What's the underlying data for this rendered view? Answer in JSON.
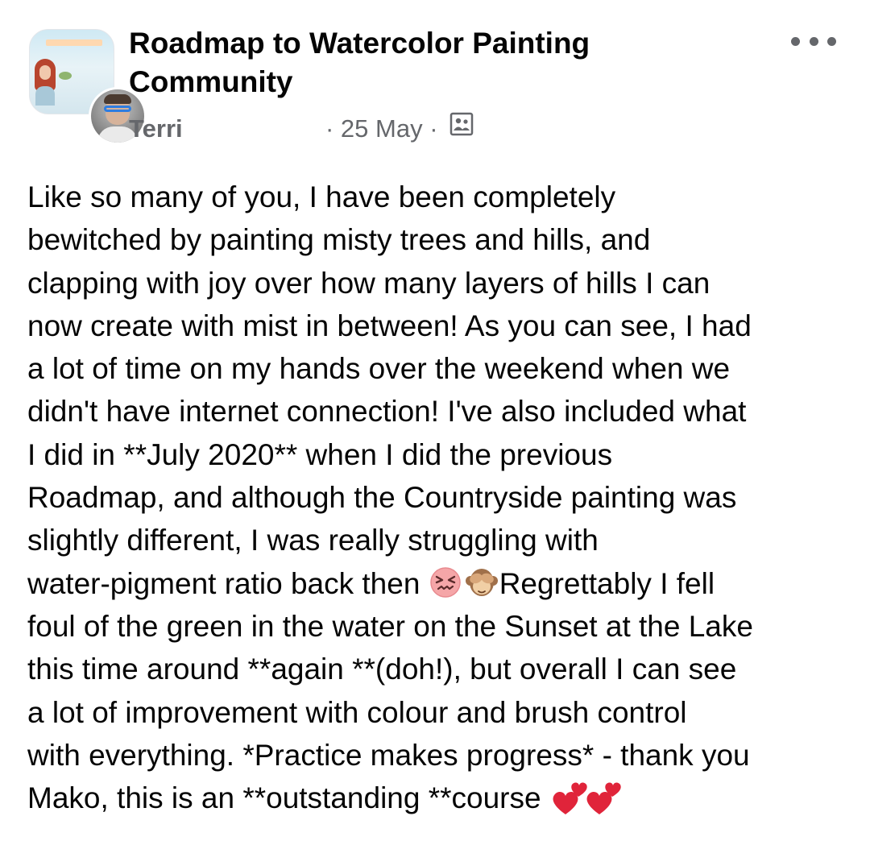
{
  "post": {
    "group_name": "Roadmap to Watercolor Painting Community",
    "author": "Terri",
    "date": "· 25 May ·",
    "audience_icon": "members-icon",
    "more_icon": "more-options-icon",
    "text_lines": [
      "Like so many of you, I have been completely",
      "bewitched by painting misty trees and hills, and",
      "clapping with joy over how many layers of hills I can",
      "now create with mist in between! As you can see, I had",
      "a lot of time on my hands over the weekend when we",
      "didn't have internet connection! I've also included what",
      "I did in **July 2020** when I did the previous",
      "Roadmap, and although the Countryside painting was",
      "slightly different, I was really struggling with",
      "foul of the green in the water on the Sunset at the Lake",
      "this time around **again **(doh!), but overall I can see",
      "a lot of improvement with colour and brush control",
      "with everything. *Practice makes progress* - thank you",
      "Mako, this is an **outstanding **course"
    ],
    "line_with_emoji_before": "water-pigment ratio back then",
    "line_with_emoji_after": "Regrettably I fell",
    "emojis": [
      "confounded-face-emoji",
      "see-no-evil-monkey-emoji",
      "two-hearts-emoji"
    ]
  }
}
